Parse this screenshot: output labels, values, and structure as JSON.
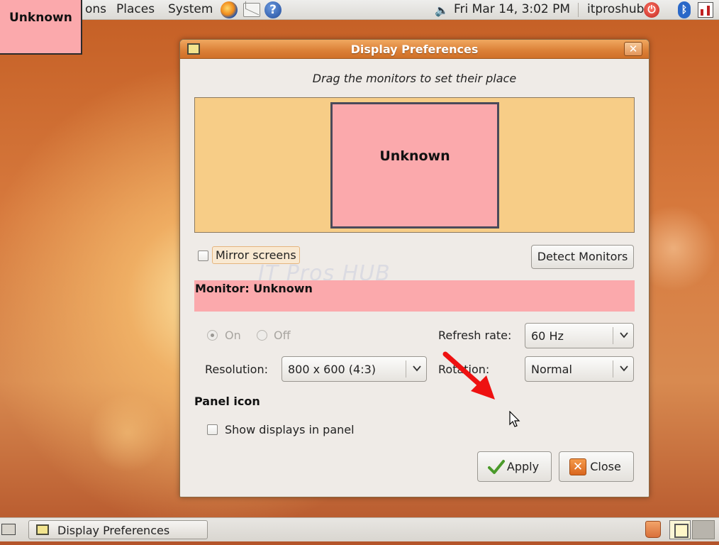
{
  "top_panel": {
    "menu_applications_fragment": "ons",
    "menu_places": "Places",
    "menu_system": "System",
    "clock": "Fri Mar 14,  3:02 PM",
    "username": "itproshub",
    "help_glyph": "?"
  },
  "floating_label": {
    "text": "Unknown"
  },
  "window": {
    "title": "Display Preferences",
    "close_glyph": "✕",
    "instructions": "Drag the monitors to set their place",
    "monitor_name": "Unknown",
    "mirror_label": "Mirror screens",
    "mirror_checked": false,
    "detect_label": "Detect Monitors",
    "watermark": "IT Pros HUB",
    "monitor_header": "Monitor: Unknown",
    "radio_on": "On",
    "radio_off": "Off",
    "refresh_label": "Refresh rate:",
    "refresh_value": "60 Hz",
    "resolution_label": "Resolution:",
    "resolution_value": "800 x 600 (4:3)",
    "rotation_label": "Rotation:",
    "rotation_value": "Normal",
    "panel_icon_heading": "Panel icon",
    "show_displays_label": "Show displays in panel",
    "show_displays_checked": false,
    "apply_label": "Apply",
    "close_label": "Close"
  },
  "bottom_panel": {
    "taskbar_label": "Display Preferences"
  },
  "colors": {
    "monitor_pink": "#fba9ac",
    "monitor_area": "#f7cd87",
    "titlebar": "#db7f36",
    "annotation_arrow": "#ee1111"
  },
  "icons": [
    "firefox-icon",
    "mail-icon",
    "help-icon",
    "volume-icon",
    "power-icon",
    "bluetooth-icon",
    "network-icon",
    "display-icon",
    "checkmark-icon",
    "close-icon",
    "trash-icon",
    "workspace-icon"
  ]
}
